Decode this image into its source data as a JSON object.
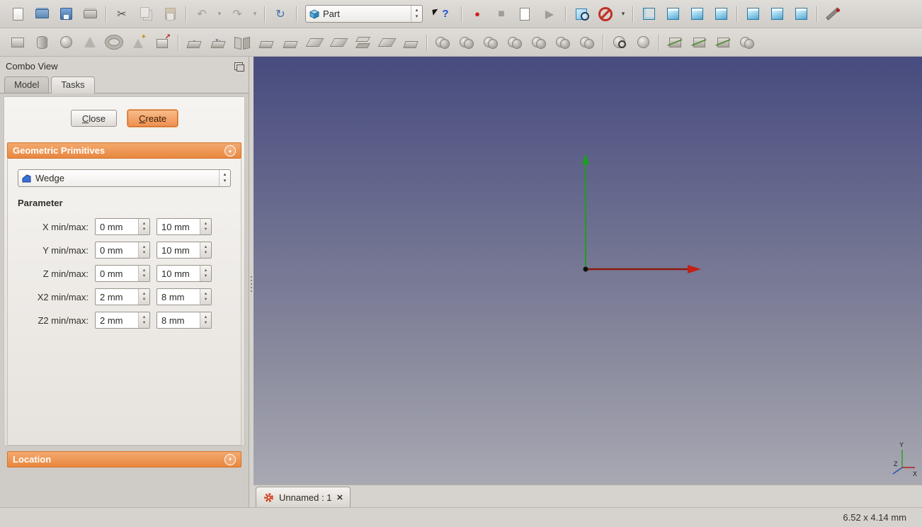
{
  "ui": {
    "spin_up": "▴",
    "spin_down": "▾",
    "close_glyph": "×"
  },
  "colors": {
    "accent_orange": "#e8873f",
    "create_button": "#ef9050",
    "viewport_top": "#474b7e",
    "viewport_bottom": "#a9a9b3",
    "axis_x_red": "#c42015",
    "axis_y_green": "#1e9e1e",
    "axis_z_blue": "#2c4fb0"
  },
  "toolbars": {
    "standard_left": [
      {
        "name": "new-document-button",
        "kind": "k-page",
        "i": true
      },
      {
        "name": "open-document-button",
        "kind": "k-open",
        "i": true
      },
      {
        "name": "save-button",
        "kind": "k-save",
        "i": true
      },
      {
        "name": "print-button",
        "kind": "k-print",
        "i": true
      },
      {
        "name": "toolbar-separator",
        "kind": "sep",
        "i": false
      },
      {
        "name": "cut-button",
        "kind": "k-glyph",
        "glyph": "✂",
        "i": true
      },
      {
        "name": "copy-button",
        "kind": "k-copy dim",
        "i": true
      },
      {
        "name": "paste-button",
        "kind": "k-paste dim",
        "i": true
      },
      {
        "name": "toolbar-separator",
        "kind": "sep",
        "i": false
      },
      {
        "name": "undo-button",
        "kind": "k-glyph dim",
        "glyph": "↶",
        "i": true
      },
      {
        "name": "undo-dropdown-arrow",
        "kind": "k-dd dim",
        "glyph": "▾",
        "i": true
      },
      {
        "name": "redo-button",
        "kind": "k-glyph dim",
        "glyph": "↷",
        "i": true
      },
      {
        "name": "redo-dropdown-arrow",
        "kind": "k-dd dim",
        "glyph": "▾",
        "i": true
      },
      {
        "name": "toolbar-separator",
        "kind": "sep",
        "i": false
      },
      {
        "name": "refresh-button",
        "kind": "k-glyph blue",
        "glyph": "↻",
        "i": true
      },
      {
        "name": "toolbar-separator",
        "kind": "sep",
        "i": false
      }
    ],
    "workbench_selector": {
      "value": "Part"
    },
    "standard_right": [
      {
        "name": "whats-this-button",
        "kind": "k-whatsthis",
        "glyph": "?",
        "i": true
      },
      {
        "name": "toolbar-separator",
        "kind": "sep",
        "i": false
      },
      {
        "name": "macro-record-button",
        "kind": "k-glyph red",
        "glyph": "●",
        "i": true
      },
      {
        "name": "macro-stop-button",
        "kind": "k-glyph dim",
        "glyph": "■",
        "i": true
      },
      {
        "name": "macro-edit-button",
        "kind": "k-edit",
        "glyph": "✎",
        "i": true
      },
      {
        "name": "macro-play-button",
        "kind": "k-glyph dim",
        "glyph": "▶",
        "i": true
      },
      {
        "name": "toolbar-separator",
        "kind": "sep",
        "i": false
      },
      {
        "name": "fit-all-button",
        "kind": "k-fitall",
        "i": true
      },
      {
        "name": "draw-style-button",
        "kind": "k-drawstyle",
        "i": true
      },
      {
        "name": "draw-style-dropdown-arrow",
        "kind": "k-dd",
        "glyph": "▾",
        "i": true
      },
      {
        "name": "toolbar-separator",
        "kind": "sep",
        "i": false
      },
      {
        "name": "view-axonometric-button",
        "kind": "k-cube wire",
        "i": true
      },
      {
        "name": "view-front-button",
        "kind": "k-cube",
        "i": true
      },
      {
        "name": "view-top-button",
        "kind": "k-cube",
        "i": true
      },
      {
        "name": "view-right-button",
        "kind": "k-cube",
        "i": true
      },
      {
        "name": "toolbar-separator",
        "kind": "sep",
        "i": false
      },
      {
        "name": "view-rear-button",
        "kind": "k-cube",
        "i": true
      },
      {
        "name": "view-bottom-button",
        "kind": "k-cube",
        "i": true
      },
      {
        "name": "view-left-button",
        "kind": "k-cube",
        "i": true
      },
      {
        "name": "toolbar-separator",
        "kind": "sep",
        "i": false
      },
      {
        "name": "measure-distance-button",
        "kind": "k-measure",
        "i": true
      }
    ],
    "part_tools": [
      {
        "name": "part-box-button",
        "kind": "k-box",
        "i": true
      },
      {
        "name": "part-cylinder-button",
        "kind": "k-cylinder",
        "i": true
      },
      {
        "name": "part-sphere-button",
        "kind": "k-sphere",
        "i": true
      },
      {
        "name": "part-cone-button",
        "kind": "k-cone",
        "i": true
      },
      {
        "name": "part-torus-button",
        "kind": "k-torus",
        "i": true
      },
      {
        "name": "part-primitives-button",
        "kind": "k-prim",
        "i": true
      },
      {
        "name": "part-shape-builder-button",
        "kind": "k-build",
        "i": true
      },
      {
        "name": "toolbar-separator",
        "kind": "sep",
        "i": false
      },
      {
        "name": "part-extrude-button",
        "kind": "k-slab",
        "glyph": "↑",
        "i": true
      },
      {
        "name": "part-revolve-button",
        "kind": "k-slab",
        "glyph": "↻",
        "i": true
      },
      {
        "name": "part-mirror-button",
        "kind": "k-mirror",
        "i": true
      },
      {
        "name": "part-fillet-button",
        "kind": "k-slab",
        "i": true
      },
      {
        "name": "part-chamfer-button",
        "kind": "k-slab",
        "i": true
      },
      {
        "name": "part-make-face-button",
        "kind": "k-plane",
        "i": true
      },
      {
        "name": "part-ruled-surface-button",
        "kind": "k-plane",
        "i": true
      },
      {
        "name": "part-loft-button",
        "kind": "k-loft",
        "i": true
      },
      {
        "name": "part-sweep-button",
        "kind": "k-plane",
        "i": true
      },
      {
        "name": "part-offset-button",
        "kind": "k-slab",
        "i": true
      },
      {
        "name": "toolbar-separator",
        "kind": "sep",
        "i": false
      },
      {
        "name": "part-boolean-button",
        "kind": "k-2sph",
        "i": true
      },
      {
        "name": "part-cut-button",
        "kind": "k-2sph",
        "i": true
      },
      {
        "name": "part-union-button",
        "kind": "k-2sph",
        "i": true
      },
      {
        "name": "part-intersection-button",
        "kind": "k-2sph",
        "i": true
      },
      {
        "name": "part-join-connect-button",
        "kind": "k-2sph",
        "i": true
      },
      {
        "name": "part-join-embed-button",
        "kind": "k-2sph",
        "i": true
      },
      {
        "name": "part-join-cutout-button",
        "kind": "k-2sph",
        "i": true
      },
      {
        "name": "toolbar-separator",
        "kind": "sep",
        "i": false
      },
      {
        "name": "part-check-geometry-button",
        "kind": "k-sphere zoom",
        "i": true
      },
      {
        "name": "part-defeaturing-button",
        "kind": "k-sphere",
        "i": true
      },
      {
        "name": "toolbar-separator",
        "kind": "sep",
        "i": false
      },
      {
        "name": "part-cross-sections-button",
        "kind": "k-xsect",
        "i": true
      },
      {
        "name": "part-slice-apart-button",
        "kind": "k-xsect",
        "i": true
      },
      {
        "name": "part-slice-button",
        "kind": "k-xsect",
        "i": true
      },
      {
        "name": "part-boolean-xor-button",
        "kind": "k-2sph",
        "i": true
      }
    ]
  },
  "combo_view": {
    "title": "Combo View",
    "tabs": [
      {
        "label": "Model",
        "state": "",
        "name": "tab-model",
        "i": true
      },
      {
        "label": "Tasks",
        "state": "active",
        "name": "tab-tasks",
        "i": true
      }
    ],
    "buttons": {
      "close": "Close",
      "create": "Create"
    },
    "primitives_section": {
      "title": "Geometric Primitives",
      "chevron": "▴"
    },
    "primitive_combo": {
      "value": "Wedge"
    },
    "parameter_heading": "Parameter",
    "parameters": [
      {
        "label": "X min/max:",
        "min": "0 mm",
        "max": "10 mm"
      },
      {
        "label": "Y min/max:",
        "min": "0 mm",
        "max": "10 mm"
      },
      {
        "label": "Z min/max:",
        "min": "0 mm",
        "max": "10 mm"
      },
      {
        "label": "X2 min/max:",
        "min": "2 mm",
        "max": "8 mm"
      },
      {
        "label": "Z2 min/max:",
        "min": "2 mm",
        "max": "8 mm"
      }
    ],
    "location_section": {
      "title": "Location",
      "chevron": "▾"
    }
  },
  "viewport": {
    "document_tab": {
      "label": "Unnamed : 1"
    },
    "axis_indicator": {
      "x": "X",
      "y": "Y",
      "z": "Z"
    }
  },
  "status_bar": {
    "dimensions": "6.52 x 4.14 mm"
  }
}
